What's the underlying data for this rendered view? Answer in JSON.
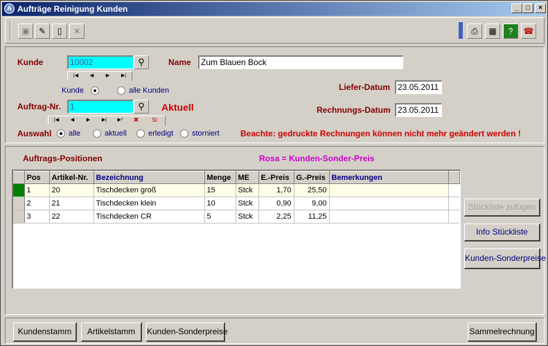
{
  "window": {
    "title": "Aufträge Reinigung Kunden"
  },
  "header": {
    "kunde_label": "Kunde",
    "kunde_value": "10002",
    "name_label": "Name",
    "name_value": "Zum Blauen Bock",
    "scope_kunde": "Kunde",
    "scope_alle": "alle Kunden",
    "auftrag_label": "Auftrag-Nr.",
    "auftrag_value": "1",
    "aktuell_label": "Aktuell",
    "liefer_label": "Liefer-Datum",
    "liefer_value": "23.05.2011",
    "rechnung_label": "Rechnungs-Datum",
    "rechnung_value": "23.05.2011",
    "auswahl_label": "Auswahl",
    "auswahl_options": [
      "alle",
      "aktuell",
      "erledigt",
      "storniert"
    ],
    "warning": "Beachte:  gedruckte Rechnungen können nicht mehr geändert werden !"
  },
  "positions": {
    "title": "Auftrags-Positionen",
    "legend": "Rosa = Kunden-Sonder-Preis",
    "columns": [
      "Pos",
      "Artikel-Nr.",
      "Bezeichnung",
      "Menge",
      "ME",
      "E.-Preis",
      "G.-Preis",
      "Bemerkungen"
    ],
    "rows": [
      {
        "pos": "1",
        "artikel": "20",
        "bez": "Tischdecken groß",
        "menge": "15",
        "me": "Stck",
        "epreis": "1,70",
        "gpreis": "25,50",
        "bem": ""
      },
      {
        "pos": "2",
        "artikel": "21",
        "bez": "Tischdecken klein",
        "menge": "10",
        "me": "Stck",
        "epreis": "0,90",
        "gpreis": "9,00",
        "bem": ""
      },
      {
        "pos": "3",
        "artikel": "22",
        "bez": "Tischdecken CR",
        "menge": "5",
        "me": "Stck",
        "epreis": "2,25",
        "gpreis": "11,25",
        "bem": ""
      }
    ]
  },
  "side_buttons": {
    "stueckliste_add": "Stückliste zufügen",
    "info_stueckliste": "Info Stückliste",
    "sonderpreise": "Kunden-Sonderpreise"
  },
  "footer": {
    "kundenstamm": "Kundenstamm",
    "artikelstamm": "Artikelstamm",
    "sonderpreise": "Kunden-Sonderpreise",
    "sammelrechnung": "Sammelrechnung"
  },
  "nav_st": "St",
  "colors": {
    "title_gradient_start": "#0a246a",
    "label_dark_red": "#800000",
    "warning_red": "#cc0000",
    "legend_magenta": "#cc00cc",
    "field_cyan": "#00ffff"
  }
}
